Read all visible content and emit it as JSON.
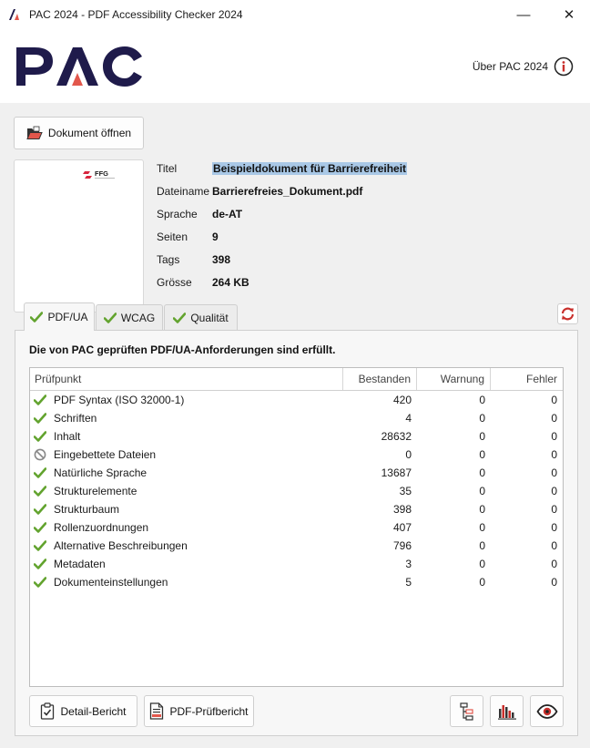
{
  "window": {
    "title": "PAC 2024 - PDF Accessibility Checker 2024",
    "minimize_glyph": "—",
    "close_glyph": "✕"
  },
  "header": {
    "logo_text": "PAC",
    "about_label": "Über PAC 2024"
  },
  "document": {
    "open_button_label": "Dokument öffnen",
    "thumbnail_logo_text": "FFG",
    "metadata": [
      {
        "label": "Titel",
        "value": "Beispieldokument für Barrierefreiheit"
      },
      {
        "label": "Dateiname",
        "value": "Barrierefreies_Dokument.pdf"
      },
      {
        "label": "Sprache",
        "value": "de-AT"
      },
      {
        "label": "Seiten",
        "value": "9"
      },
      {
        "label": "Tags",
        "value": "398"
      },
      {
        "label": "Grösse",
        "value": "264 KB"
      }
    ]
  },
  "tabs": [
    {
      "label": "PDF/UA",
      "active": true
    },
    {
      "label": "WCAG",
      "active": false
    },
    {
      "label": "Qualität",
      "active": false
    }
  ],
  "results": {
    "status_text": "Die von PAC geprüften PDF/UA-Anforderungen sind erfüllt.",
    "columns": [
      "Prüfpunkt",
      "Bestanden",
      "Warnung",
      "Fehler"
    ],
    "rows": [
      {
        "name": "PDF Syntax (ISO 32000-1)",
        "status": "pass",
        "passed": "420",
        "warnings": "0",
        "errors": "0"
      },
      {
        "name": "Schriften",
        "status": "pass",
        "passed": "4",
        "warnings": "0",
        "errors": "0"
      },
      {
        "name": "Inhalt",
        "status": "pass",
        "passed": "28632",
        "warnings": "0",
        "errors": "0"
      },
      {
        "name": "Eingebettete Dateien",
        "status": "not-applicable",
        "passed": "0",
        "warnings": "0",
        "errors": "0"
      },
      {
        "name": "Natürliche Sprache",
        "status": "pass",
        "passed": "13687",
        "warnings": "0",
        "errors": "0"
      },
      {
        "name": "Strukturelemente",
        "status": "pass",
        "passed": "35",
        "warnings": "0",
        "errors": "0"
      },
      {
        "name": "Strukturbaum",
        "status": "pass",
        "passed": "398",
        "warnings": "0",
        "errors": "0"
      },
      {
        "name": "Rollenzuordnungen",
        "status": "pass",
        "passed": "407",
        "warnings": "0",
        "errors": "0"
      },
      {
        "name": "Alternative Beschreibungen",
        "status": "pass",
        "passed": "796",
        "warnings": "0",
        "errors": "0"
      },
      {
        "name": "Metadaten",
        "status": "pass",
        "passed": "3",
        "warnings": "0",
        "errors": "0"
      },
      {
        "name": "Dokumenteinstellungen",
        "status": "pass",
        "passed": "5",
        "warnings": "0",
        "errors": "0"
      }
    ]
  },
  "footer": {
    "detail_report_label": "Detail-Bericht",
    "pdf_report_label": "PDF-Prüfbericht"
  },
  "colors": {
    "brand_navy": "#1f1b4b",
    "brand_red": "#e2574c",
    "check_green": "#62a32e",
    "icon_red": "#c9302c",
    "highlight": "#a9c8e6"
  }
}
